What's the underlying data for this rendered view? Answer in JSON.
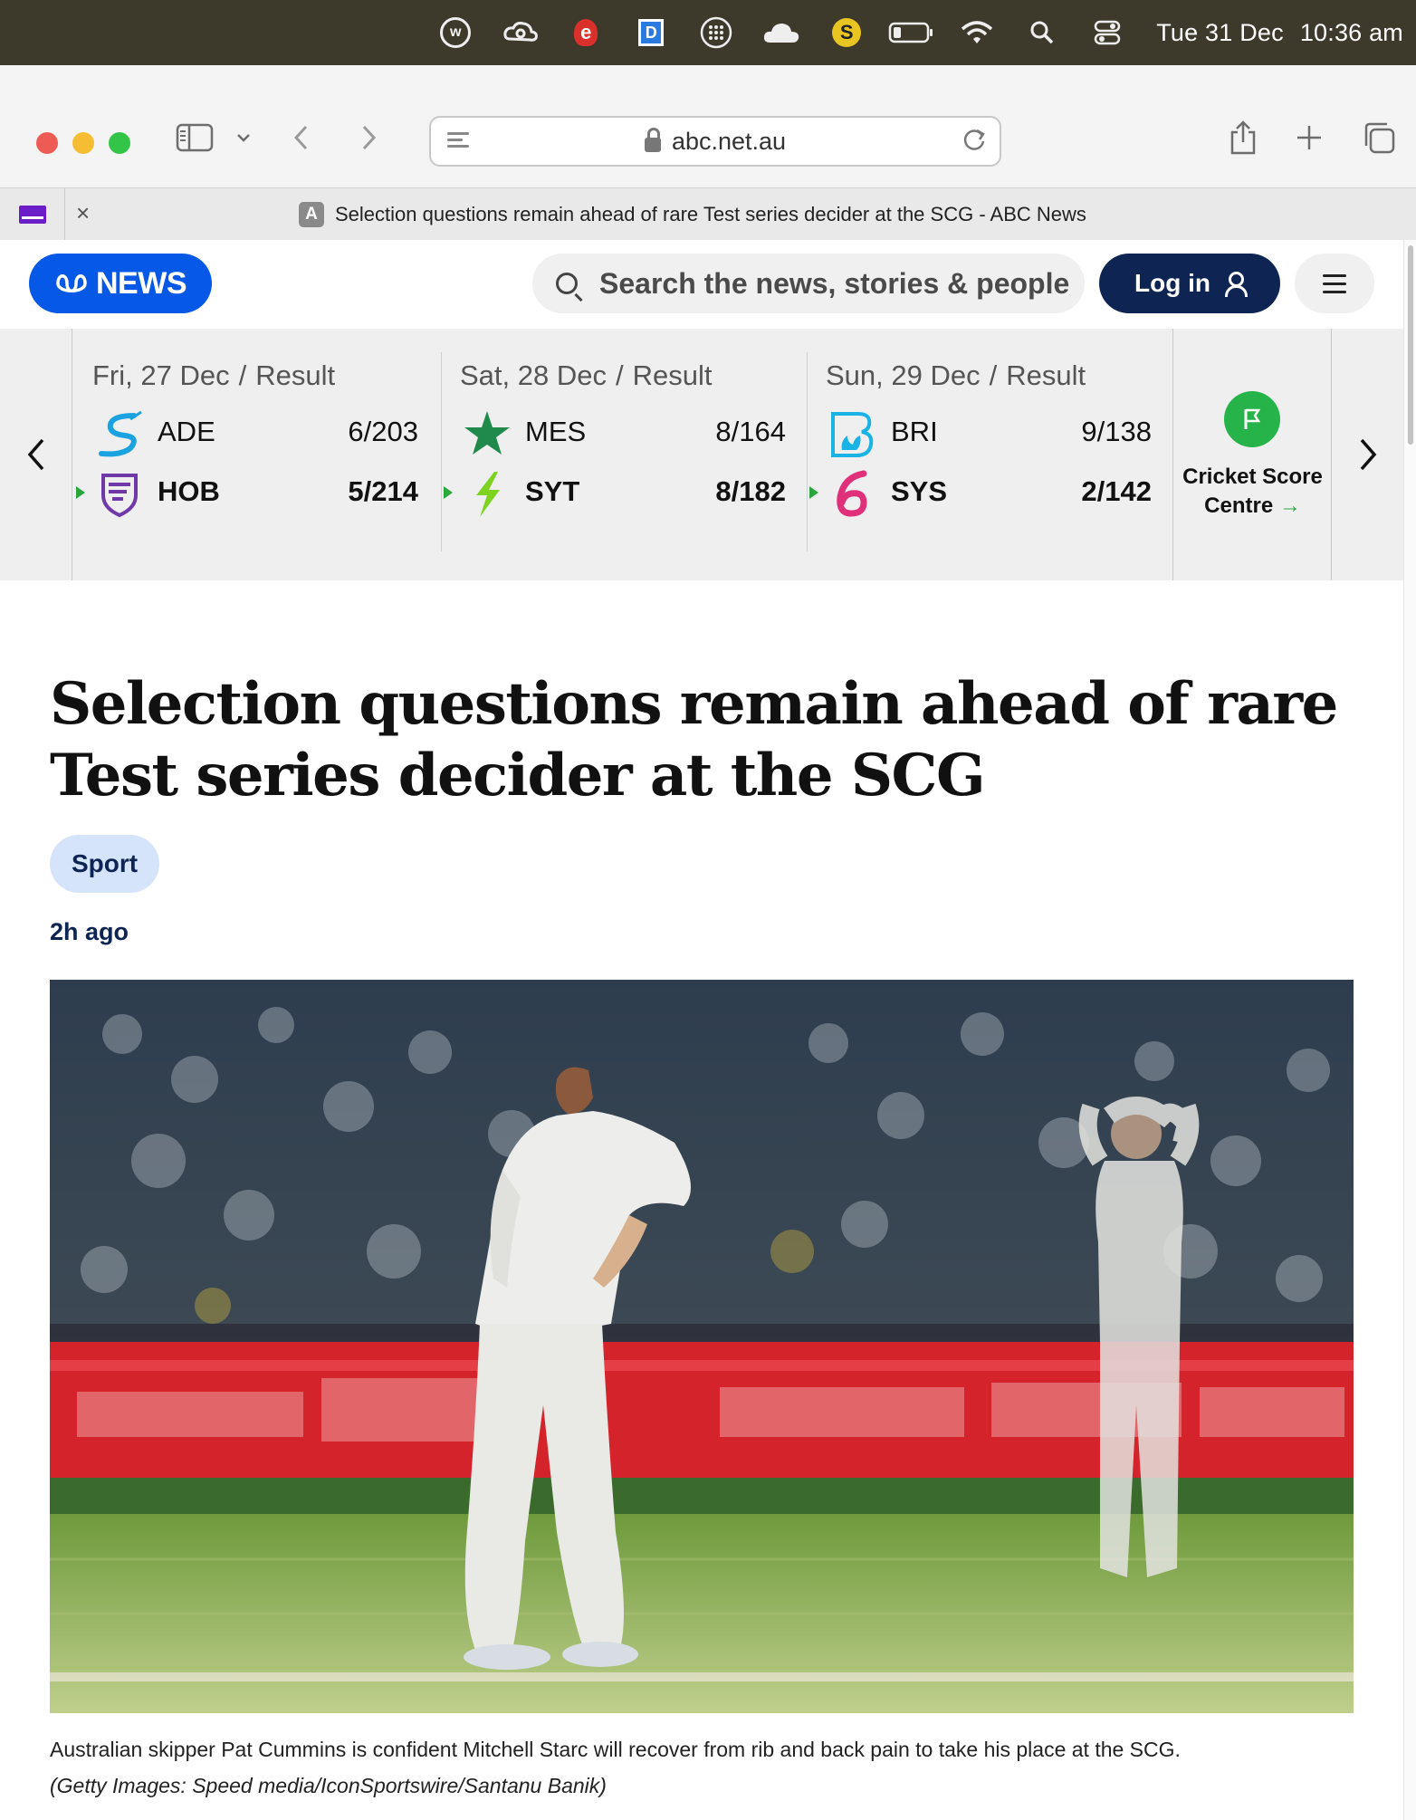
{
  "menubar": {
    "icons": [
      "w-circle-icon",
      "creative-cloud-icon",
      "e-app-icon",
      "d-app-icon",
      "grid-dots-icon",
      "cloud-icon",
      "s-coin-icon",
      "battery-icon",
      "wifi-icon",
      "search-icon",
      "control-center-icon"
    ],
    "letters": {
      "w": "w",
      "e": "e",
      "d": "D",
      "s": "S"
    },
    "date": "Tue 31 Dec",
    "time": "10:36 am"
  },
  "browser": {
    "url": "abc.net.au",
    "tab_title": "Selection questions remain ahead of rare Test series decider at the SCG - ABC News",
    "tab_favicon": "A",
    "close_glyph": "×"
  },
  "header": {
    "logo_text": "NEWS",
    "search_placeholder": "Search the news, stories & people",
    "login_label": "Log in"
  },
  "scores": {
    "matches": [
      {
        "date": "Fri, 27 Dec",
        "status": "Result",
        "teams": [
          {
            "code": "ADE",
            "score": "6/203",
            "winner": false,
            "color": "#1aa3e0"
          },
          {
            "code": "HOB",
            "score": "5/214",
            "winner": true,
            "color": "#6f3aa8"
          }
        ]
      },
      {
        "date": "Sat, 28 Dec",
        "status": "Result",
        "teams": [
          {
            "code": "MES",
            "score": "8/164",
            "winner": false,
            "color": "#1f8a4c"
          },
          {
            "code": "SYT",
            "score": "8/182",
            "winner": true,
            "color": "#7ed321"
          }
        ]
      },
      {
        "date": "Sun, 29 Dec",
        "status": "Result",
        "teams": [
          {
            "code": "BRI",
            "score": "9/138",
            "winner": false,
            "color": "#1ab3e6"
          },
          {
            "code": "SYS",
            "score": "2/142",
            "winner": true,
            "color": "#e0307a"
          }
        ]
      }
    ],
    "separator": "/",
    "score_centre_line1": "Cricket Score",
    "score_centre_line2": "Centre",
    "arrow": "→"
  },
  "article": {
    "headline": "Selection questions remain ahead of rare Test series decider at the SCG",
    "tag": "Sport",
    "time_ago": "2h ago",
    "caption": "Australian skipper Pat Cummins is confident Mitchell Starc will recover from rib and back pain to take his place at the SCG.",
    "credit": "(Getty Images: Speed media/IconSportswire/Santanu Banik)"
  },
  "colors": {
    "abc_blue": "#0658e6",
    "navy": "#0e2553",
    "tag_bg": "#d6e4fb",
    "win_green": "#2aa63c"
  }
}
